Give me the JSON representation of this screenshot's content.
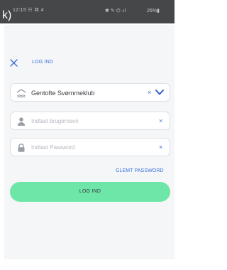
{
  "status_bar": {
    "time": "12:15 ☷ ⌘ 4",
    "icons": "✱ ✎ ⌬ .ıl",
    "battery": "26%▮"
  },
  "stray_text": "k)",
  "header": {
    "close_icon": "close-icon",
    "title": "LOG IND"
  },
  "form": {
    "club": {
      "icon": "club-building-icon",
      "value": "Gentofte Svømmeklub",
      "clear": "×"
    },
    "username": {
      "icon": "user-icon",
      "placeholder": "Indtast brugernavn",
      "clear": "×"
    },
    "password": {
      "icon": "lock-icon",
      "placeholder": "Indtast Password",
      "clear": "×"
    },
    "forgot_password": "GLEMT PASSWORD",
    "login_button": "LOG IND"
  },
  "colors": {
    "accent": "#3a6fd8",
    "button": "#6ee6a7",
    "status_bar": "#454749"
  }
}
